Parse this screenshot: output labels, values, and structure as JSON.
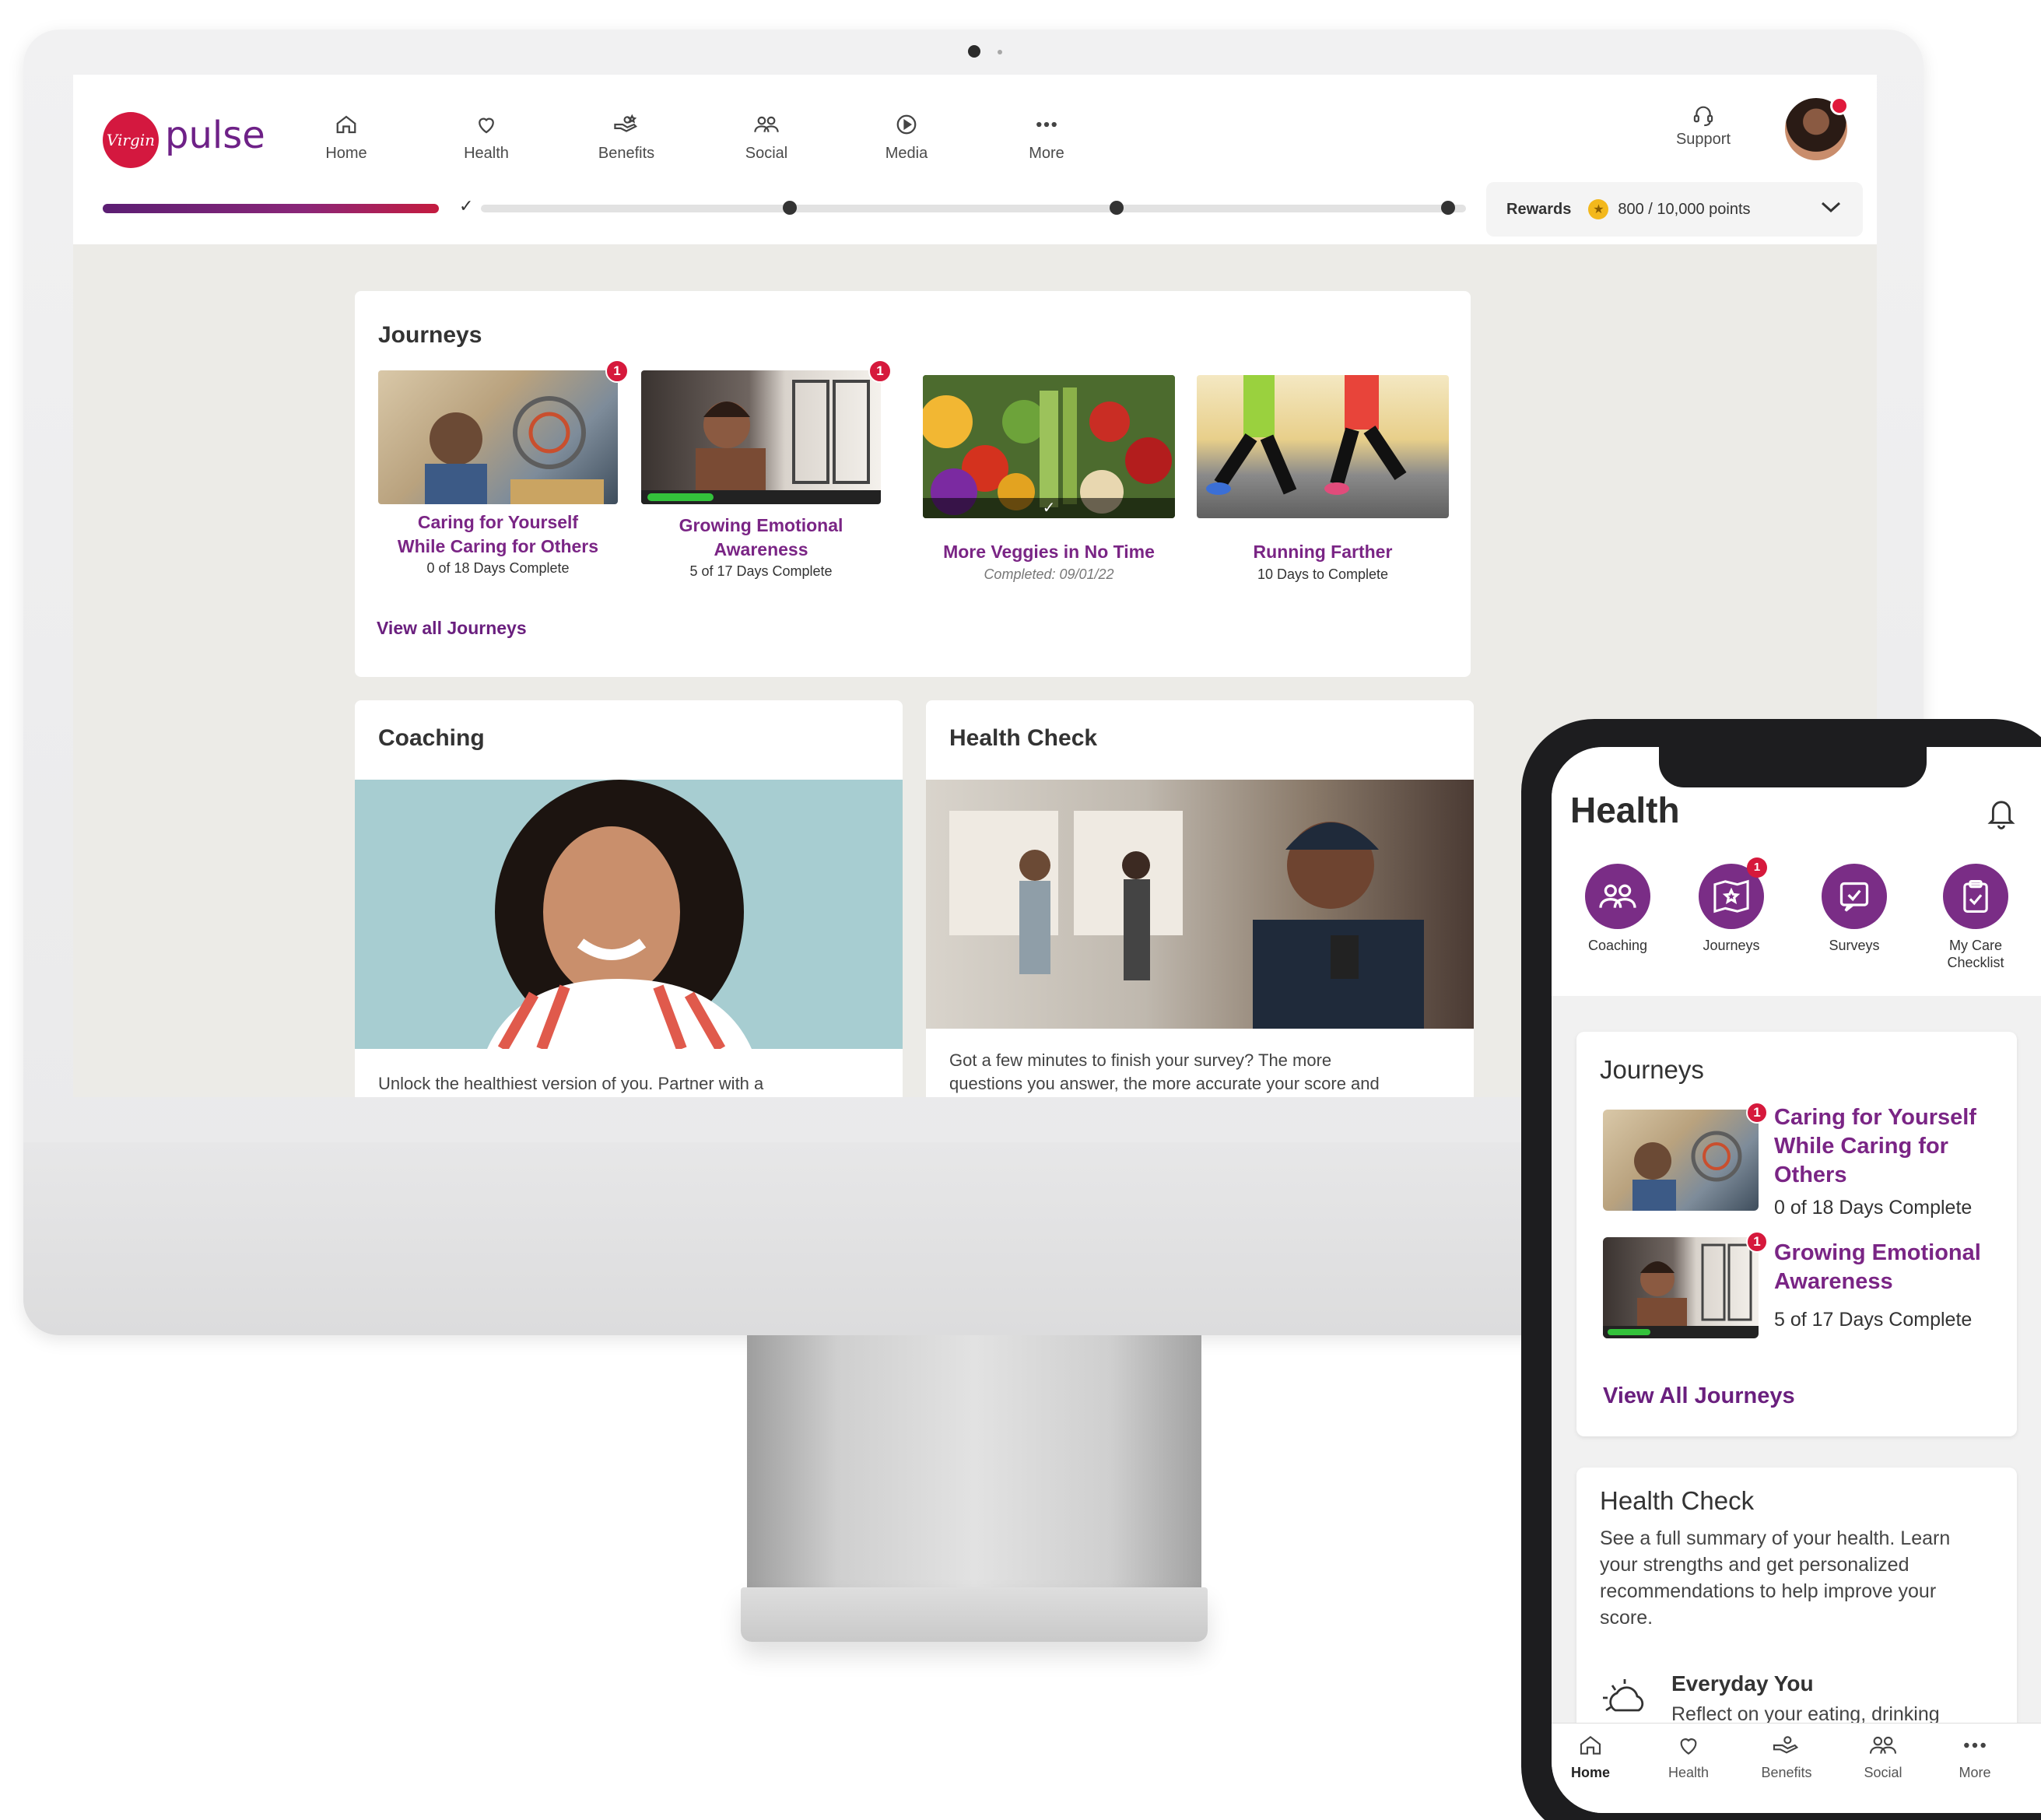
{
  "brand": {
    "logo_mark": "Virgin",
    "name": "pulse"
  },
  "desktop": {
    "nav": [
      {
        "label": "Home",
        "icon": "home-icon"
      },
      {
        "label": "Health",
        "icon": "heart-icon"
      },
      {
        "label": "Benefits",
        "icon": "hand-coins-icon"
      },
      {
        "label": "Social",
        "icon": "people-icon"
      },
      {
        "label": "Media",
        "icon": "play-icon"
      },
      {
        "label": "More",
        "icon": "more-dots-icon"
      }
    ],
    "support_label": "Support",
    "rewards": {
      "label": "Rewards",
      "points": "800 / 10,000 points",
      "progress_fraction": 0.08
    },
    "journeys": {
      "title": "Journeys",
      "items": [
        {
          "title_line1": "Caring for Yourself",
          "title_line2": "While Caring for Others",
          "status": "0 of 18 Days Complete",
          "badge": "1"
        },
        {
          "title_line1": "Growing Emotional",
          "title_line2": "Awareness",
          "status": "5 of 17 Days Complete",
          "badge": "1",
          "progress_fraction": 0.29
        },
        {
          "title_line1": "More Veggies in No Time",
          "status": "Completed: 09/01/22"
        },
        {
          "title_line1": "Running Farther",
          "status": "10 Days to Complete"
        }
      ],
      "view_all": "View all Journeys"
    },
    "coaching": {
      "title": "Coaching",
      "body": "Unlock the healthiest version of you. Partner with a"
    },
    "health_check": {
      "title": "Health Check",
      "body_line1": "Got a few minutes to finish your survey? The more",
      "body_line2": "questions you answer, the more accurate your score and"
    }
  },
  "phone": {
    "title": "Health",
    "categories": [
      {
        "label": "Coaching",
        "icon": "coaching-icon"
      },
      {
        "label": "Journeys",
        "icon": "journey-map-icon",
        "badge": "1"
      },
      {
        "label": "Surveys",
        "icon": "survey-icon"
      },
      {
        "label_line1": "My Care",
        "label_line2": "Checklist",
        "icon": "checklist-icon"
      }
    ],
    "journeys": {
      "title": "Journeys",
      "items": [
        {
          "title_lines": [
            "Caring for Yourself",
            "While Caring for",
            "Others"
          ],
          "status": "0 of 18 Days Complete",
          "badge": "1"
        },
        {
          "title_lines": [
            "Growing Emotional",
            "Awareness"
          ],
          "status": "5 of 17 Days Complete",
          "badge": "1"
        }
      ],
      "view_all": "View All Journeys"
    },
    "health_check": {
      "title": "Health Check",
      "body_lines": [
        "See a full summary of your health. Learn",
        "your strengths and get personalized",
        "recommendations to help improve your",
        "score."
      ],
      "item_title": "Everyday You",
      "item_body": "Reflect on your eating, drinking"
    },
    "tabs": [
      {
        "label": "Home",
        "icon": "home-icon",
        "active": true
      },
      {
        "label": "Health",
        "icon": "heart-icon"
      },
      {
        "label": "Benefits",
        "icon": "hand-coins-icon"
      },
      {
        "label": "Social",
        "icon": "people-icon"
      },
      {
        "label": "More",
        "icon": "more-dots-icon"
      }
    ]
  },
  "colors": {
    "brand_purple": "#7a2585",
    "brand_red": "#d4183f",
    "badge_red": "#d6193c",
    "progress_green": "#2ecc40"
  }
}
